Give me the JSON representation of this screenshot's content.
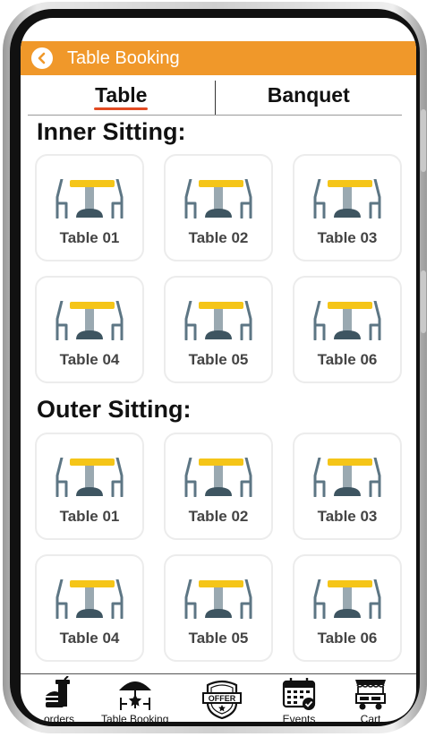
{
  "header": {
    "title": "Table Booking"
  },
  "tabs": [
    {
      "label": "Table"
    },
    {
      "label": "Banquet"
    }
  ],
  "sections": [
    {
      "title": "Inner Sitting:",
      "tables": [
        "Table 01",
        "Table 02",
        "Table 03",
        "Table 04",
        "Table 05",
        "Table 06"
      ]
    },
    {
      "title": "Outer Sitting:",
      "tables": [
        "Table 01",
        "Table 02",
        "Table 03",
        "Table 04",
        "Table 05",
        "Table 06"
      ]
    }
  ],
  "nav": [
    {
      "label": "orders",
      "icon": "burger-drink-icon"
    },
    {
      "label": "Table Booking",
      "icon": "umbrella-table-icon"
    },
    {
      "label": "",
      "icon": "offer-badge-icon",
      "badge_text": "OFFER"
    },
    {
      "label": "Events",
      "icon": "calendar-check-icon"
    },
    {
      "label": "Cart",
      "icon": "food-cart-icon"
    }
  ],
  "colors": {
    "header": "#f0982a",
    "tab_underline": "#e24a22",
    "table_top": "#f5c518",
    "chair": "#5d7684"
  }
}
